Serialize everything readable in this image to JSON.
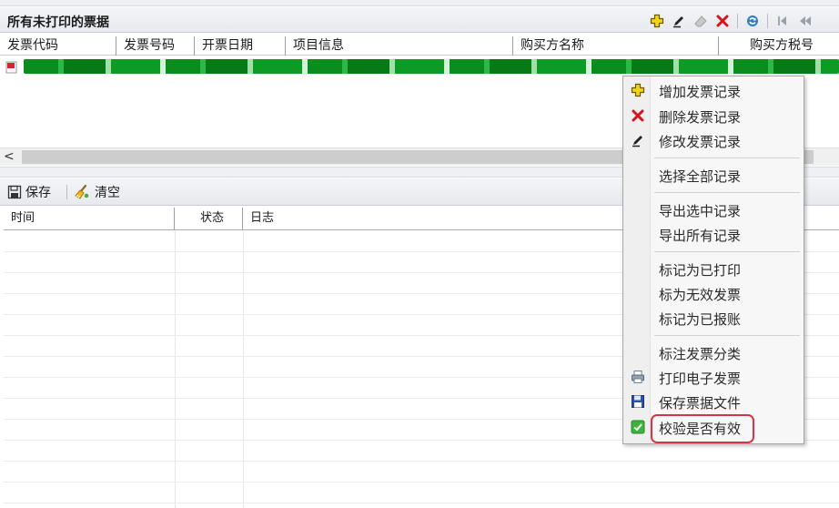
{
  "top_panel": {
    "title": "所有未打印的票据",
    "columns": [
      "发票代码",
      "发票号码",
      "开票日期",
      "项目信息",
      "购买方名称",
      "购买方税号"
    ],
    "scroll_left_label": "<"
  },
  "log_panel": {
    "save_label": "保存",
    "clear_label": "清空",
    "columns": [
      "时间",
      "状态",
      "日志"
    ]
  },
  "context_menu": {
    "groups": [
      [
        "增加发票记录",
        "删除发票记录",
        "修改发票记录"
      ],
      [
        "选择全部记录"
      ],
      [
        "导出选中记录",
        "导出所有记录"
      ],
      [
        "标记为已打印",
        "标为无效发票",
        "标记为已报账"
      ],
      [
        "标注发票分类",
        "打印电子发票",
        "保存票据文件",
        "校验是否有效"
      ]
    ]
  },
  "icons": {
    "toolbar": [
      "add-icon",
      "edit-icon",
      "erase-icon",
      "delete-icon",
      "refresh-icon",
      "first-page-icon",
      "prev-page-icon"
    ],
    "menu": [
      "add-icon",
      "delete-icon",
      "edit-icon",
      "printer-icon",
      "save-disk-icon",
      "check-icon"
    ]
  },
  "colors": {
    "accent_add": "#e6c200",
    "delete": "#d3151e",
    "check": "#3cb43c",
    "highlight_border": "#d6344a",
    "masked_row": "#0b8d1e"
  }
}
